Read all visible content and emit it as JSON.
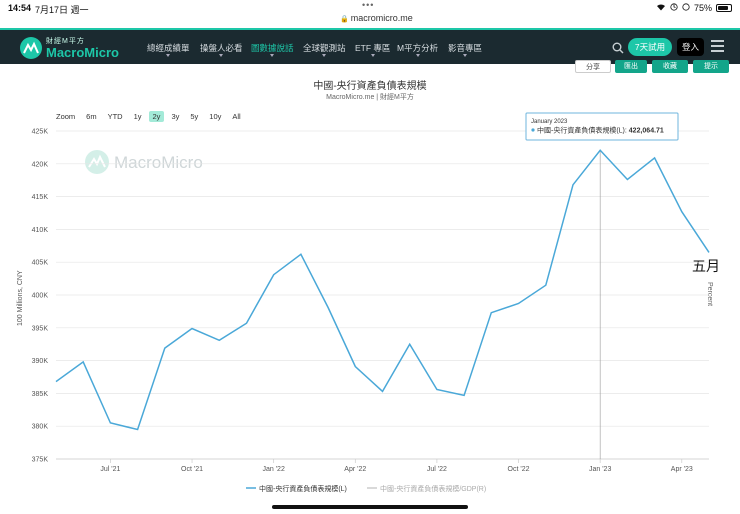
{
  "status_bar": {
    "time": "14:54",
    "date": "7月17日 週一",
    "url": "macromicro.me",
    "battery": "75%"
  },
  "nav": {
    "logo_sub": "財經M平方",
    "logo_name": "MacroMicro",
    "items": [
      "總經成績單",
      "操盤人必看",
      "圖數據說話",
      "全球觀測站",
      "ETF 專區",
      "M平方分析",
      "影音專區"
    ],
    "active_index": 2,
    "trial_label": "7天試用",
    "login_label": "登入"
  },
  "toolbar": {
    "share_label": "分享",
    "download_label": "匯出",
    "save_label": "收藏",
    "alert_label": "提示"
  },
  "zoom": {
    "label": "Zoom",
    "options": [
      "6m",
      "YTD",
      "1y",
      "2y",
      "3y",
      "5y",
      "10y",
      "All"
    ],
    "selected": "2y"
  },
  "chart_data": {
    "type": "line",
    "title": "中國-央行資產負債表規模",
    "subtitle": "MacroMicro.me | 財經M平方",
    "ylabel": "100 Millions, CNY",
    "y2label": "Percent",
    "ylim": [
      375000,
      425000
    ],
    "yticks": [
      "375K",
      "380K",
      "385K",
      "390K",
      "395K",
      "400K",
      "405K",
      "410K",
      "415K",
      "420K",
      "425K"
    ],
    "xticks": [
      "Jul '21",
      "Oct '21",
      "Jan '22",
      "Apr '22",
      "Jul '22",
      "Oct '22",
      "Jan '23",
      "Apr '23"
    ],
    "x": [
      "2021-05",
      "2021-06",
      "2021-07",
      "2021-08",
      "2021-09",
      "2021-10",
      "2021-11",
      "2021-12",
      "2022-01",
      "2022-02",
      "2022-03",
      "2022-04",
      "2022-05",
      "2022-06",
      "2022-07",
      "2022-08",
      "2022-09",
      "2022-10",
      "2022-11",
      "2022-12",
      "2023-01",
      "2023-02",
      "2023-03",
      "2023-04",
      "2023-05"
    ],
    "series": [
      {
        "name": "中國-央行資產負債表規模(L)",
        "color": "#4aa8d8",
        "values": [
          386800,
          389800,
          380500,
          379500,
          391900,
          394900,
          393100,
          395700,
          403100,
          406200,
          398100,
          389100,
          385300,
          392500,
          385600,
          384700,
          397300,
          398700,
          401500,
          416800,
          422065,
          417600,
          420900,
          412700,
          406500
        ]
      },
      {
        "name": "中國-央行資產負債表規模/GDP(R)",
        "color": "#cccccc",
        "values": []
      }
    ],
    "tooltip": {
      "date": "January 2023",
      "series": "中國-央行資產負債表規模(L)",
      "value": "422,064.71"
    },
    "watermark": "MacroMicro",
    "annotation": "五月"
  }
}
